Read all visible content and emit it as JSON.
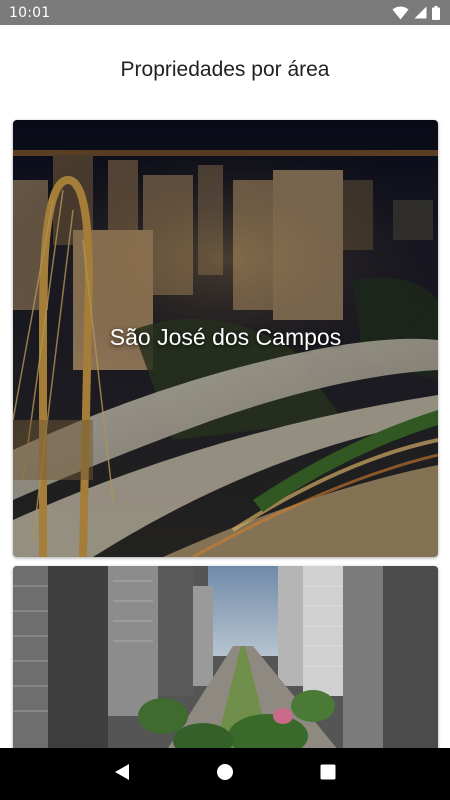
{
  "status_bar": {
    "time": "10:01",
    "icons": [
      "wifi-icon",
      "cellular-signal-icon",
      "battery-icon"
    ]
  },
  "page": {
    "title": "Propriedades por área"
  },
  "areas": [
    {
      "name": "São José dos Campos",
      "image": "night-city-bridge-photo"
    },
    {
      "name": "",
      "image": "city-avenue-photo"
    }
  ],
  "nav_bar": {
    "buttons": [
      "back-icon",
      "home-icon",
      "recents-icon"
    ]
  },
  "colors": {
    "status_bar": "#7a7a7a",
    "nav_bar": "#000000",
    "title_text": "#212121",
    "card_label": "#ffffff"
  }
}
